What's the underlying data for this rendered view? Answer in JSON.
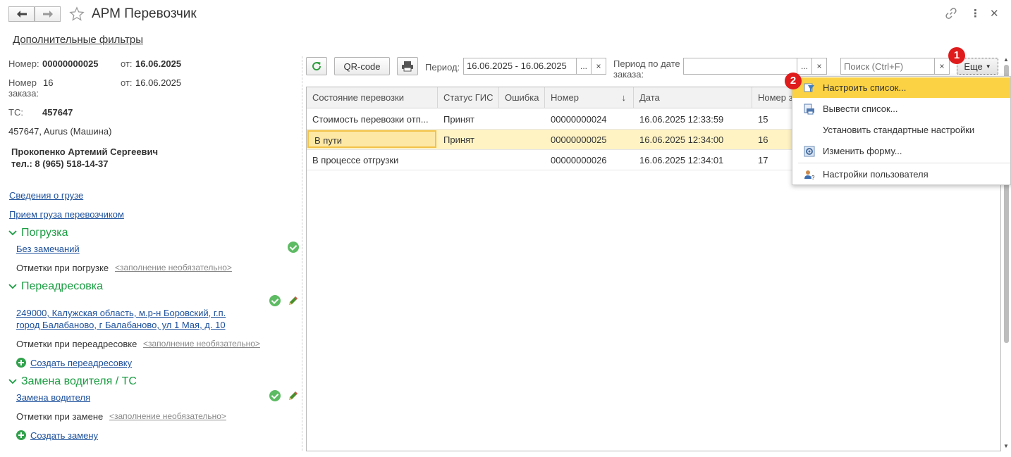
{
  "window": {
    "title": "АРМ Перевозчик",
    "back_icon": "arrow-left-icon",
    "forward_icon": "arrow-right-icon",
    "star_icon": "star-outline-icon",
    "link_icon": "link-icon",
    "more_icon": "vertical-dots-icon",
    "close_icon": "close-icon"
  },
  "left": {
    "filters_link": "Дополнительные фильтры",
    "number_label": "Номер:",
    "number_value": "00000000025",
    "number_from_label": "от:",
    "number_from_value": "16.06.2025",
    "order_label": "Номер заказа:",
    "order_value": "16",
    "order_from_label": "от:",
    "order_from_value": "16.06.2025",
    "ts_label": "ТС:",
    "ts_value": "457647",
    "vehicle": "457647, Aurus (Машина)",
    "driver_name": "Прокопенко Артемий Сергеевич",
    "driver_phone": "тел.: 8 (965) 518-14-37",
    "cargo_link": "Сведения о грузе",
    "acceptance_link": "Прием груза перевозчиком",
    "loading": {
      "title": "Погрузка",
      "status_link": "Без замечаний",
      "notes_label": "Отметки при погрузке",
      "notes_hint": "<заполнение необязательно>"
    },
    "readdress": {
      "title": "Переадресовка",
      "address_line1": "249000, Калужская область, м.р-н Боровский, г.п.",
      "address_line2": "город Балабаново, г Балабаново, ул 1 Мая, д. 10",
      "notes_label": "Отметки при переадресовке",
      "notes_hint": "<заполнение необязательно>",
      "create_link": "Создать переадресовку"
    },
    "driver_change": {
      "title": "Замена водителя / ТС",
      "link": "Замена водителя",
      "notes_label": "Отметки при замене",
      "notes_hint": "<заполнение необязательно>",
      "create_link": "Создать замену"
    }
  },
  "toolbar": {
    "refresh_icon": "refresh-icon",
    "qr_label": "QR-code",
    "print_icon": "printer-icon",
    "period_label": "Период:",
    "period_value": "16.06.2025 - 16.06.2025",
    "order_period_label_1": "Период по дате",
    "order_period_label_2": "заказа:",
    "order_period_value": "",
    "ellipsis": "...",
    "clear": "×",
    "search_placeholder": "Поиск (Ctrl+F)",
    "more_label": "Еще"
  },
  "table": {
    "columns": [
      "Состояние перевозки",
      "Статус ГИС",
      "Ошибка",
      "Номер",
      "Дата",
      "Номер з"
    ],
    "sort_indicator": "↓",
    "rows": [
      [
        "Стоимость перевозки отп...",
        "Принят",
        "",
        "00000000024",
        "16.06.2025 12:33:59",
        "15"
      ],
      [
        "В пути",
        "Принят",
        "",
        "00000000025",
        "16.06.2025 12:34:00",
        "16"
      ],
      [
        "В процессе отгрузки",
        "",
        "",
        "00000000026",
        "16.06.2025 12:34:01",
        "17"
      ]
    ]
  },
  "menu": {
    "items": [
      {
        "label": "Настроить список...",
        "icon": "filter-list-icon"
      },
      {
        "label": "Вывести список...",
        "icon": "output-list-icon"
      },
      {
        "label": "Установить стандартные настройки",
        "icon": ""
      },
      {
        "label": "Изменить форму...",
        "icon": "form-edit-icon"
      },
      {
        "label": "Настройки пользователя",
        "icon": "user-settings-icon"
      }
    ]
  },
  "annotations": {
    "badge1": "1",
    "badge2": "2"
  },
  "colors": {
    "section_green": "#1a9c42",
    "link_blue": "#1b4f9c",
    "selected_row": "#fff3c4",
    "menu_highlight": "#fbd244",
    "badge_red": "#e01b1b"
  }
}
